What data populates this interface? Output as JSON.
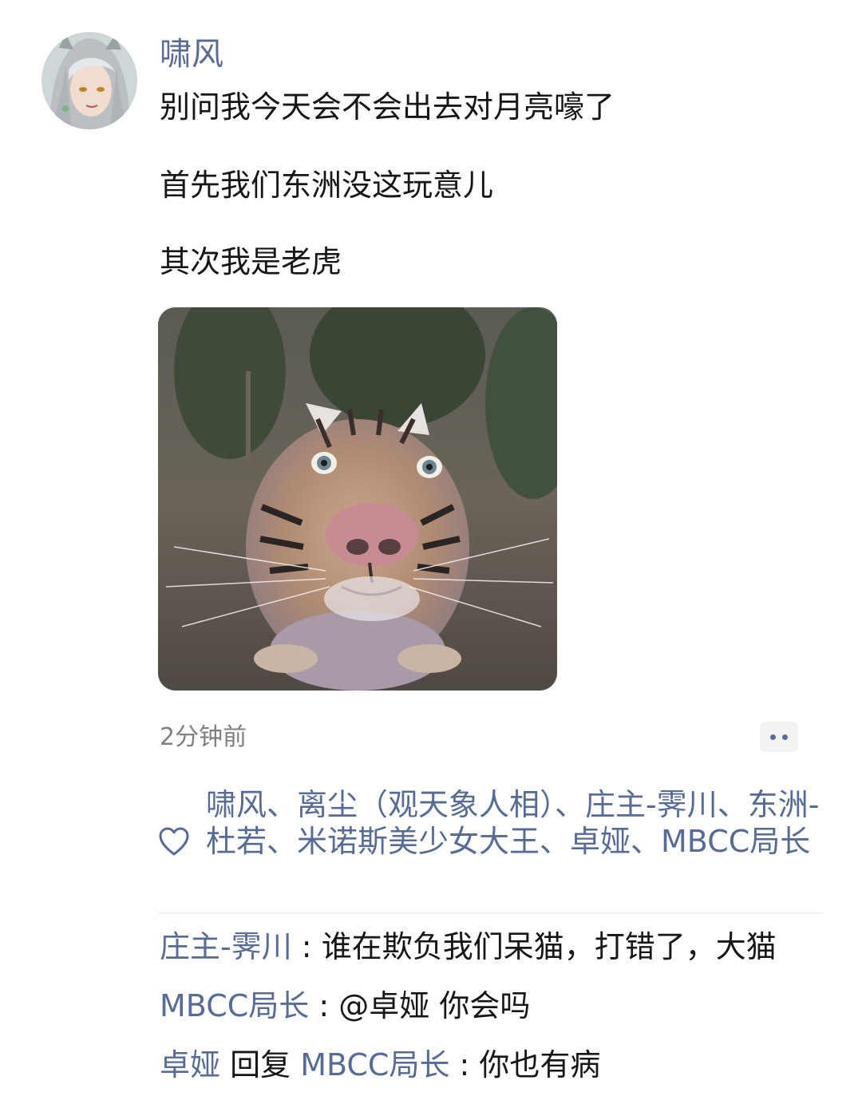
{
  "post": {
    "author": "啸风",
    "lines": [
      "别问我今天会不会出去对月亮嚎了",
      "首先我们东洲没这玩意儿",
      "其次我是老虎"
    ],
    "time": "2分钟前"
  },
  "likes": {
    "text": "啸风、离尘（观天象人相）、庄主-霁川、东洲-杜若、米诺斯美少女大王、卓娅、MBCC局长"
  },
  "comments": [
    {
      "author": "庄主-霁川",
      "sep": " : ",
      "text": "谁在欺负我们呆猫，打错了，大猫"
    },
    {
      "author": "MBCC局长",
      "sep": " : ",
      "text": "@卓娅 你会吗"
    },
    {
      "author": "卓娅",
      "reply_word": " 回复 ",
      "reply_to": "MBCC局长",
      "sep": " : ",
      "text": "你也有病"
    }
  ],
  "colors": {
    "link": "#576b95",
    "text": "#161616",
    "muted": "#7f7f7f"
  },
  "icons": [
    "avatar",
    "heart-icon",
    "more-dots-icon"
  ]
}
